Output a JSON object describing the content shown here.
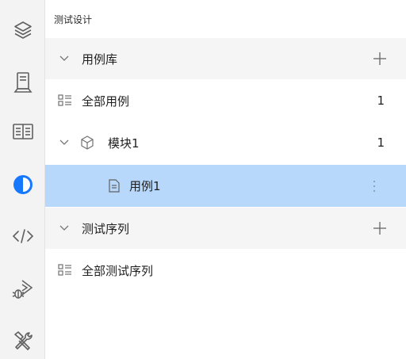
{
  "panel": {
    "title": "测试设计"
  },
  "sidebar_icons": [
    "layers-icon",
    "device-icon",
    "book-icon",
    "contrast-icon",
    "code-icon",
    "bug-run-icon",
    "tools-icon"
  ],
  "tree": {
    "case_library": {
      "label": "用例库",
      "expanded": true,
      "all_cases": {
        "label": "全部用例",
        "count": "1"
      },
      "module": {
        "label": "模块1",
        "count": "1",
        "expanded": true
      },
      "case": {
        "label": "用例1",
        "selected": true
      }
    },
    "test_sequence": {
      "label": "测试序列",
      "expanded": true,
      "all_sequences": {
        "label": "全部测试序列"
      }
    }
  },
  "colors": {
    "selected_bg": "#b8d8fb",
    "rail_bg": "#f3f3f3",
    "section_bg": "#f5f5f5",
    "active_icon": "#1677ff"
  }
}
